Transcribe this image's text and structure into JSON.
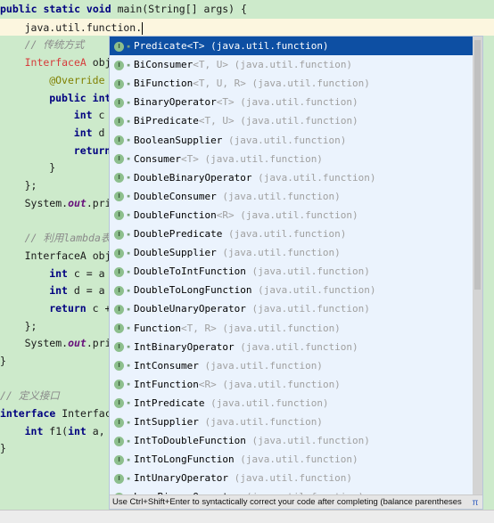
{
  "editor": {
    "lines": [
      {
        "parts": [
          [
            "kw",
            "public static void "
          ],
          [
            "",
            "main(String[] args) {"
          ]
        ],
        "indent": 0
      },
      {
        "parts": [
          [
            "",
            "java.util.function."
          ]
        ],
        "indent": 4,
        "caret": true
      },
      {
        "parts": [
          [
            "cm",
            "// 传统方式"
          ]
        ],
        "indent": 4
      },
      {
        "parts": [
          [
            "red",
            "InterfaceA"
          ],
          [
            "",
            " obje"
          ]
        ],
        "indent": 4
      },
      {
        "parts": [
          [
            "ann",
            "@Override"
          ]
        ],
        "indent": 8
      },
      {
        "parts": [
          [
            "kw",
            "public int"
          ]
        ],
        "indent": 8
      },
      {
        "parts": [
          [
            "kw",
            "int"
          ],
          [
            "",
            " c ="
          ]
        ],
        "indent": 12
      },
      {
        "parts": [
          [
            "kw",
            "int"
          ],
          [
            "",
            " d ="
          ]
        ],
        "indent": 12
      },
      {
        "parts": [
          [
            "kw",
            "return"
          ]
        ],
        "indent": 12
      },
      {
        "parts": [
          [
            "",
            "}"
          ]
        ],
        "indent": 8
      },
      {
        "parts": [
          [
            "",
            "};"
          ]
        ],
        "indent": 4
      },
      {
        "parts": [
          [
            "",
            "System."
          ],
          [
            "it",
            "out"
          ],
          [
            "",
            ".prir"
          ]
        ],
        "indent": 4
      },
      {
        "parts": [],
        "indent": 0
      },
      {
        "parts": [
          [
            "cm",
            "// 利用lambda表"
          ]
        ],
        "indent": 4
      },
      {
        "parts": [
          [
            "",
            "InterfaceA obje"
          ]
        ],
        "indent": 4
      },
      {
        "parts": [
          [
            "kw",
            "int"
          ],
          [
            "",
            " c = a +"
          ]
        ],
        "indent": 8
      },
      {
        "parts": [
          [
            "kw",
            "int"
          ],
          [
            "",
            " d = a *"
          ]
        ],
        "indent": 8
      },
      {
        "parts": [
          [
            "kw",
            "return"
          ],
          [
            "",
            " c +"
          ]
        ],
        "indent": 8
      },
      {
        "parts": [
          [
            "",
            "};"
          ]
        ],
        "indent": 4
      },
      {
        "parts": [
          [
            "",
            "System."
          ],
          [
            "it",
            "out"
          ],
          [
            "",
            ".prir"
          ]
        ],
        "indent": 4
      },
      {
        "parts": [
          [
            "",
            "}"
          ]
        ],
        "indent": 0
      },
      {
        "parts": [],
        "indent": 0
      },
      {
        "parts": [
          [
            "cm",
            "// 定义接口"
          ]
        ],
        "indent": 0
      },
      {
        "parts": [
          [
            "kw",
            "interface"
          ],
          [
            "",
            " Interfac"
          ]
        ],
        "indent": 0
      },
      {
        "parts": [
          [
            "kw",
            "int"
          ],
          [
            "",
            " f1("
          ],
          [
            "kw",
            "int"
          ],
          [
            "",
            " a,"
          ]
        ],
        "indent": 4
      },
      {
        "parts": [
          [
            "",
            "}"
          ]
        ],
        "indent": 0
      }
    ]
  },
  "completion": {
    "icon_letter": "I",
    "items": [
      {
        "name": "Predicate",
        "type": "<T>",
        "pkg": "(java.util.function)",
        "selected": true
      },
      {
        "name": "BiConsumer",
        "type": "<T, U>",
        "pkg": "(java.util.function)"
      },
      {
        "name": "BiFunction",
        "type": "<T, U, R>",
        "pkg": "(java.util.function)"
      },
      {
        "name": "BinaryOperator",
        "type": "<T>",
        "pkg": "(java.util.function)"
      },
      {
        "name": "BiPredicate",
        "type": "<T, U>",
        "pkg": "(java.util.function)"
      },
      {
        "name": "BooleanSupplier",
        "type": "",
        "pkg": "(java.util.function)"
      },
      {
        "name": "Consumer",
        "type": "<T>",
        "pkg": "(java.util.function)"
      },
      {
        "name": "DoubleBinaryOperator",
        "type": "",
        "pkg": "(java.util.function)"
      },
      {
        "name": "DoubleConsumer",
        "type": "",
        "pkg": "(java.util.function)"
      },
      {
        "name": "DoubleFunction",
        "type": "<R>",
        "pkg": "(java.util.function)"
      },
      {
        "name": "DoublePredicate",
        "type": "",
        "pkg": "(java.util.function)"
      },
      {
        "name": "DoubleSupplier",
        "type": "",
        "pkg": "(java.util.function)"
      },
      {
        "name": "DoubleToIntFunction",
        "type": "",
        "pkg": "(java.util.function)"
      },
      {
        "name": "DoubleToLongFunction",
        "type": "",
        "pkg": "(java.util.function)"
      },
      {
        "name": "DoubleUnaryOperator",
        "type": "",
        "pkg": "(java.util.function)"
      },
      {
        "name": "Function",
        "type": "<T, R>",
        "pkg": "(java.util.function)"
      },
      {
        "name": "IntBinaryOperator",
        "type": "",
        "pkg": "(java.util.function)"
      },
      {
        "name": "IntConsumer",
        "type": "",
        "pkg": "(java.util.function)"
      },
      {
        "name": "IntFunction",
        "type": "<R>",
        "pkg": "(java.util.function)"
      },
      {
        "name": "IntPredicate",
        "type": "",
        "pkg": "(java.util.function)"
      },
      {
        "name": "IntSupplier",
        "type": "",
        "pkg": "(java.util.function)"
      },
      {
        "name": "IntToDoubleFunction",
        "type": "",
        "pkg": "(java.util.function)"
      },
      {
        "name": "IntToLongFunction",
        "type": "",
        "pkg": "(java.util.function)"
      },
      {
        "name": "IntUnaryOperator",
        "type": "",
        "pkg": "(java.util.function)"
      },
      {
        "name": "LongBinaryOperator",
        "type": "",
        "pkg": "(java.util.function)"
      }
    ],
    "footer": {
      "hint": "Use Ctrl+Shift+Enter to syntactically correct your code after completing (balance parentheses etc.)",
      "link": ">>",
      "pi": "π"
    }
  },
  "colors": {
    "background": "#cdeacb",
    "selection": "#0d4fa3",
    "popup": "#ebf3fd"
  }
}
